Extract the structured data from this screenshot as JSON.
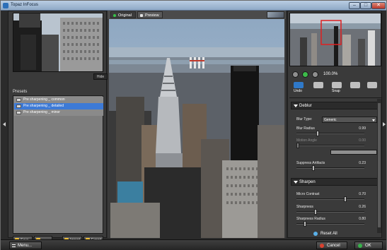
{
  "window": {
    "title": "Topaz InFocus"
  },
  "left": {
    "hide_label": "Hide",
    "presets_label": "Presets",
    "presets": [
      {
        "label": "Pre sharpening _ common",
        "selected": false
      },
      {
        "label": "Pre sharpening _ detailed",
        "selected": true
      },
      {
        "label": "Pre sharpening _ minor",
        "selected": false
      }
    ],
    "toolbar": {
      "save": "Save",
      "import": "Import",
      "export": "Export"
    }
  },
  "center": {
    "tab_original": "Original",
    "tab_preview": "Preview"
  },
  "right": {
    "zoom_level": "100.0%",
    "tools": {
      "undo": "Undo",
      "snap": "Snap"
    },
    "deblur": {
      "title": "Deblur",
      "blur_type_label": "Blur Type:",
      "blur_type_value": "Generic",
      "blur_radius_label": "Blur Radius",
      "blur_radius_value": "0.99",
      "blur_radius_level": 0.3,
      "motion_angle_label": "Motion Angle",
      "motion_angle_value": "0.00",
      "motion_angle_level": 0.0,
      "suppress_label": "Suppress Artifacts",
      "suppress_value": "0.23",
      "suppress_level": 0.23
    },
    "sharpen": {
      "title": "Sharpen",
      "micro_contrast_label": "Micro Contrast",
      "micro_contrast_value": "0.70",
      "micro_contrast_level": 0.7,
      "sharpness_label": "Sharpness",
      "sharpness_value": "0.26",
      "sharpness_level": 0.26,
      "sharpness_radius_label": "Sharpness Radius",
      "sharpness_radius_value": "0.80",
      "sharpness_radius_level": 0.1
    },
    "reset_label": "Reset All"
  },
  "bottom": {
    "menu_label": "Menu...",
    "cancel_label": "Cancel",
    "ok_label": "OK"
  }
}
